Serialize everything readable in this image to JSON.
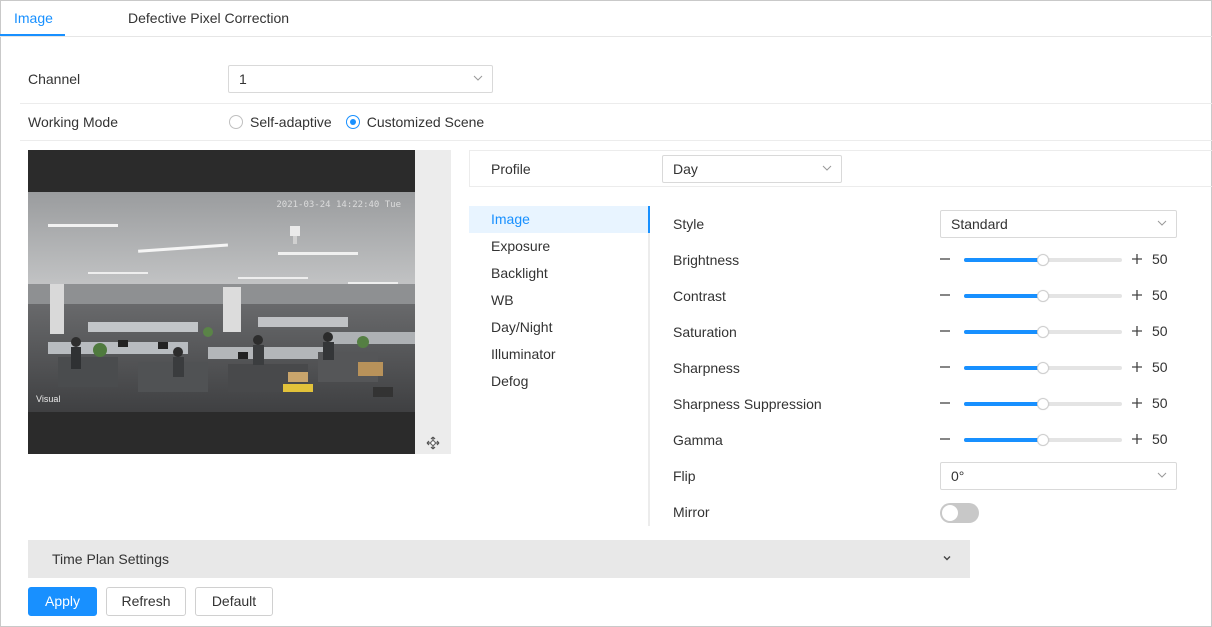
{
  "tabs": [
    {
      "label": "Image",
      "active": true
    },
    {
      "label": "Defective Pixel Correction",
      "active": false
    }
  ],
  "channel": {
    "label": "Channel",
    "value": "1"
  },
  "working_mode": {
    "label": "Working Mode",
    "options": [
      {
        "label": "Self-adaptive",
        "selected": false
      },
      {
        "label": "Customized Scene",
        "selected": true
      }
    ]
  },
  "preview": {
    "timestamp": "2021-03-24 14:22:40 Tue",
    "channel_name": "Visual"
  },
  "profile": {
    "label": "Profile",
    "value": "Day"
  },
  "menu": {
    "items": [
      {
        "label": "Image",
        "active": true
      },
      {
        "label": "Exposure",
        "active": false
      },
      {
        "label": "Backlight",
        "active": false
      },
      {
        "label": "WB",
        "active": false
      },
      {
        "label": "Day/Night",
        "active": false
      },
      {
        "label": "Illuminator",
        "active": false
      },
      {
        "label": "Defog",
        "active": false
      }
    ]
  },
  "settings": {
    "style": {
      "label": "Style",
      "value": "Standard"
    },
    "sliders": [
      {
        "label": "Brightness",
        "value": 50
      },
      {
        "label": "Contrast",
        "value": 50
      },
      {
        "label": "Saturation",
        "value": 50
      },
      {
        "label": "Sharpness",
        "value": 50
      },
      {
        "label": "Sharpness Suppression",
        "value": 50
      },
      {
        "label": "Gamma",
        "value": 50
      }
    ],
    "flip": {
      "label": "Flip",
      "value": "0°"
    },
    "mirror": {
      "label": "Mirror",
      "on": false
    }
  },
  "time_plan": {
    "label": "Time Plan Settings"
  },
  "buttons": {
    "apply": "Apply",
    "refresh": "Refresh",
    "default": "Default"
  },
  "colors": {
    "accent": "#1890ff",
    "track": "#e4e4e4",
    "panel": "#e8e8e8"
  }
}
